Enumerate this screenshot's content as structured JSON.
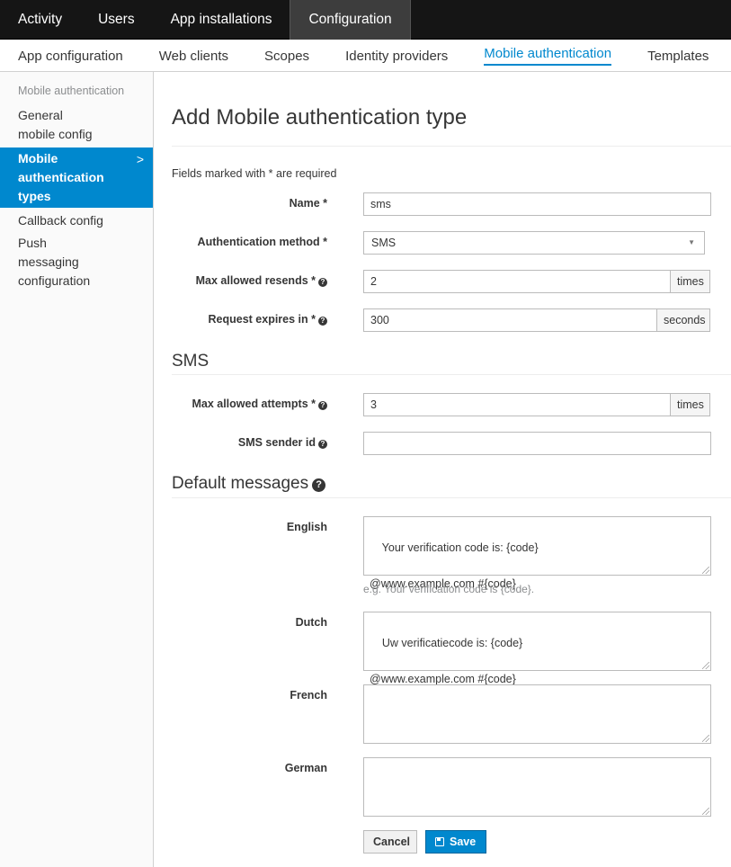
{
  "topnav": {
    "tabs": [
      "Activity",
      "Users",
      "App installations",
      "Configuration"
    ],
    "active_index": 3
  },
  "subnav": {
    "tabs": [
      "App configuration",
      "Web clients",
      "Scopes",
      "Identity providers",
      "Mobile authentication",
      "Templates"
    ],
    "active_index": 4
  },
  "sidebar": {
    "heading": "Mobile authentication",
    "items": [
      {
        "label": "General mobile config"
      },
      {
        "label": "Mobile authentication types",
        "chevron": ">"
      },
      {
        "label": "Callback config"
      },
      {
        "label": "Push messaging configuration"
      }
    ]
  },
  "main": {
    "title": "Add Mobile authentication type",
    "required_note": "Fields marked with * are required",
    "fields": {
      "name": {
        "label": "Name *",
        "value": "sms"
      },
      "auth_method": {
        "label": "Authentication method *",
        "value": "SMS"
      },
      "max_resends": {
        "label": "Max allowed resends *",
        "value": "2",
        "addon": "times"
      },
      "request_expires": {
        "label": "Request expires in *",
        "value": "300",
        "addon": "seconds"
      }
    },
    "sms_section": {
      "title": "SMS",
      "max_attempts": {
        "label": "Max allowed attempts *",
        "value": "3",
        "addon": "times"
      },
      "sender_id": {
        "label": "SMS sender id",
        "value": ""
      }
    },
    "messages_section": {
      "title": "Default messages",
      "english": {
        "label": "English",
        "value": "Your verification code is: {code}\n\n@www.example.com #{code}",
        "help": "e.g. Your verification code is {code}."
      },
      "dutch": {
        "label": "Dutch",
        "value": "Uw verificatiecode is: {code}\n\n@www.example.com #{code}"
      },
      "french": {
        "label": "French",
        "value": ""
      },
      "german": {
        "label": "German",
        "value": ""
      }
    },
    "buttons": {
      "cancel": "Cancel",
      "save": "Save"
    }
  },
  "colors": {
    "accent": "#0088ce",
    "topnav_bg": "#151515",
    "topnav_active": "#3d3d3d"
  },
  "icons": [
    "help-icon",
    "save-icon",
    "chevron-right-icon",
    "caret-down-icon"
  ]
}
